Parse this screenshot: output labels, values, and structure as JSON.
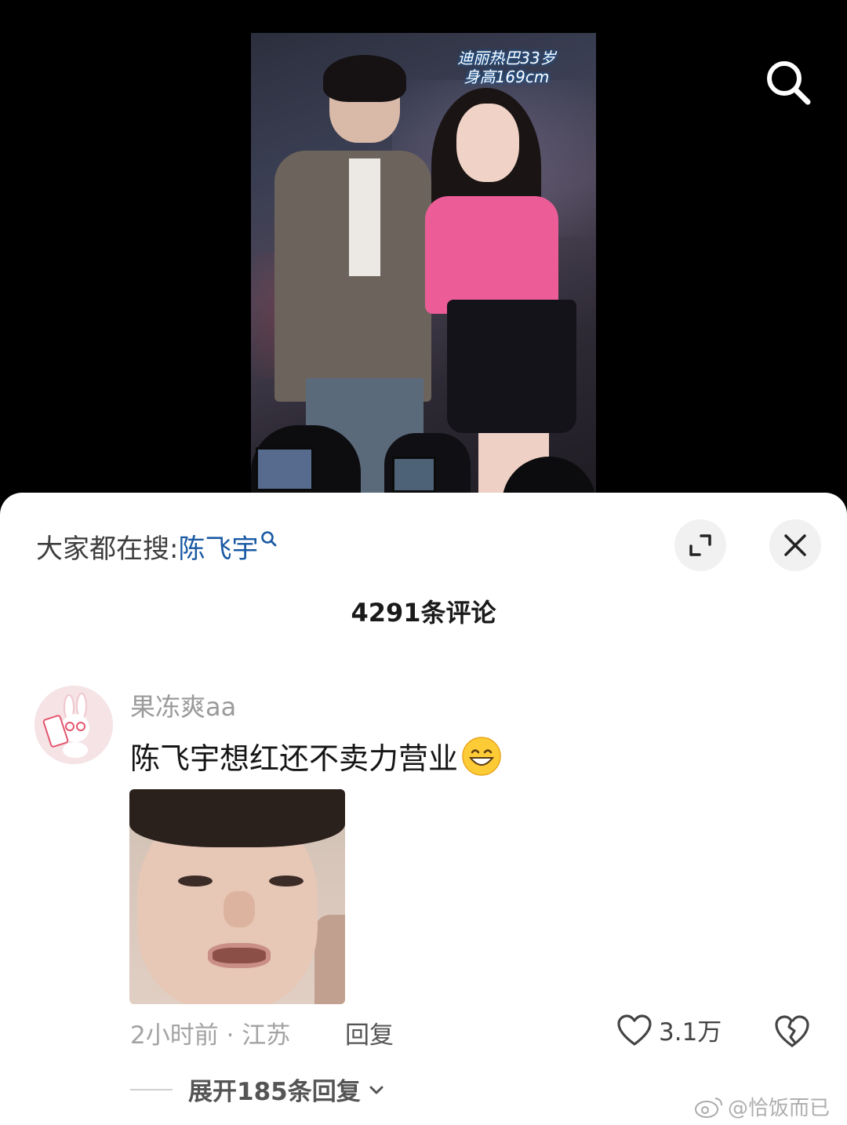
{
  "video": {
    "caption_line1": "迪丽热巴33岁",
    "caption_line2": "身高169cm"
  },
  "top_actions": {
    "search_icon": "search-icon"
  },
  "sheet": {
    "hot_search_prefix": "大家都在搜:",
    "hot_search_term": "陈飞宇",
    "expand_icon": "expand-icon",
    "close_icon": "close-icon",
    "comment_count": "4291条评论"
  },
  "comment": {
    "username": "果冻爽aa",
    "text": "陈飞宇想红还不卖力营业",
    "emoji": "grinning-face-emoji",
    "time_location": "2小时前 · 江苏",
    "reply_label": "回复",
    "like_count": "3.1万",
    "expand_replies_label": "展开185条回复"
  },
  "watermark": {
    "text": "@恰饭而已"
  },
  "colors": {
    "link_blue": "#1b5aa4",
    "video_bg": "#000000",
    "sheet_bg": "#ffffff"
  }
}
